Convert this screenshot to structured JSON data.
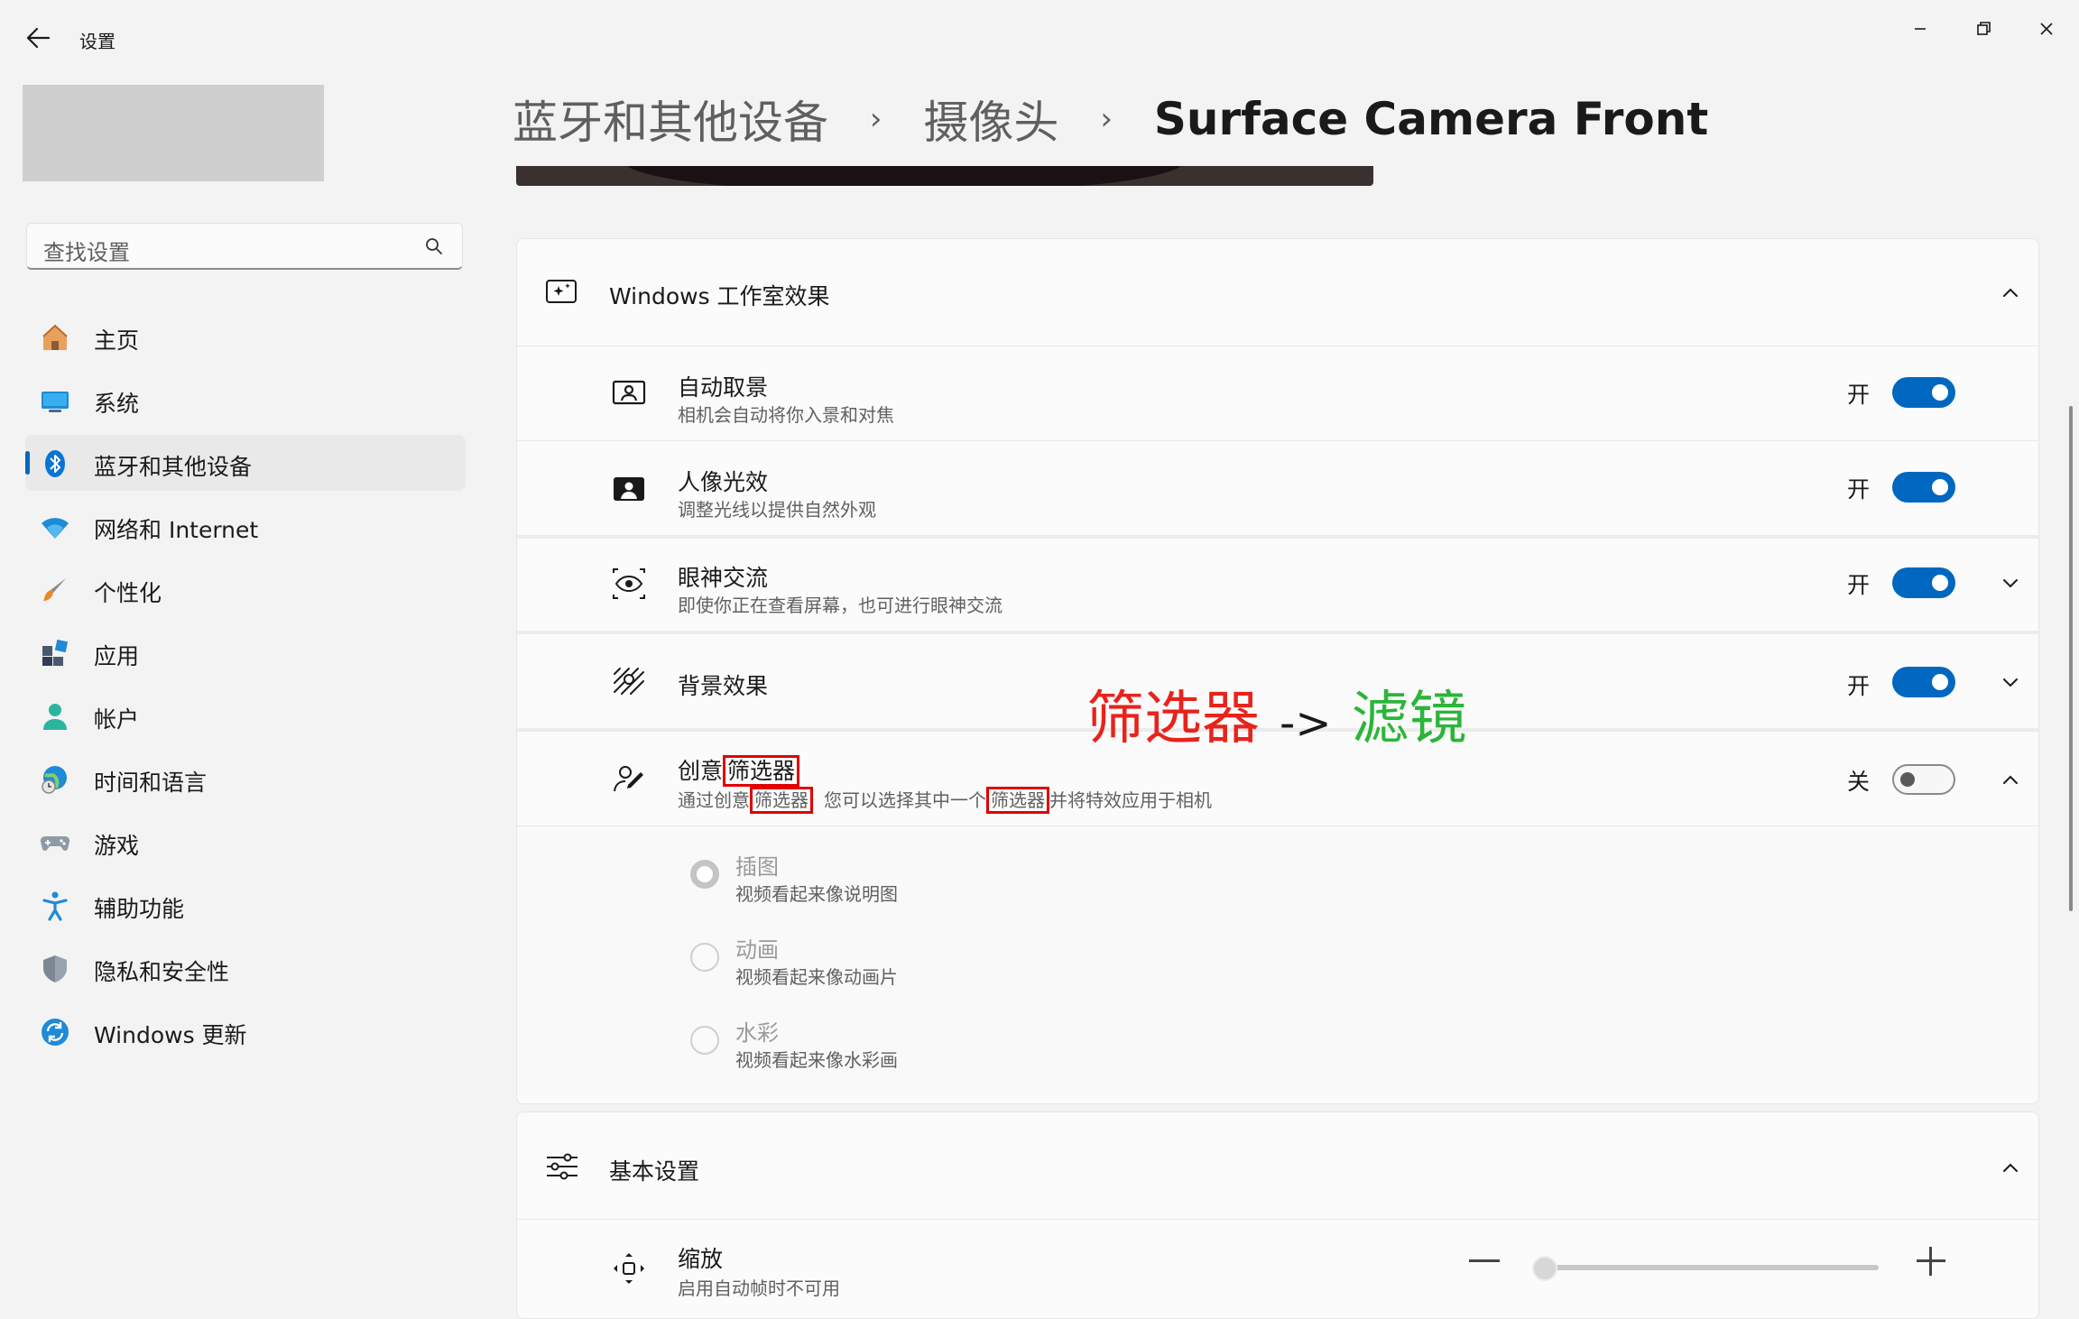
{
  "app": {
    "title": "设置"
  },
  "search": {
    "placeholder": "查找设置"
  },
  "sidebar": {
    "items": [
      {
        "label": "主页"
      },
      {
        "label": "系统"
      },
      {
        "label": "蓝牙和其他设备"
      },
      {
        "label": "网络和 Internet"
      },
      {
        "label": "个性化"
      },
      {
        "label": "应用"
      },
      {
        "label": "帐户"
      },
      {
        "label": "时间和语言"
      },
      {
        "label": "游戏"
      },
      {
        "label": "辅助功能"
      },
      {
        "label": "隐私和安全性"
      },
      {
        "label": "Windows 更新"
      }
    ],
    "active_index": 2
  },
  "breadcrumb": {
    "items": [
      "蓝牙和其他设备",
      "摄像头",
      "Surface Camera Front"
    ],
    "separator": "›"
  },
  "studio_effects": {
    "title": "Windows 工作室效果",
    "rows": [
      {
        "title": "自动取景",
        "subtitle": "相机会自动将你入景和对焦",
        "state": "开",
        "on": true
      },
      {
        "title": "人像光效",
        "subtitle": "调整光线以提供自然外观",
        "state": "开",
        "on": true
      },
      {
        "title": "眼神交流",
        "subtitle": "即使你正在查看屏幕，也可进行眼神交流",
        "state": "开",
        "on": true
      },
      {
        "title": "背景效果",
        "subtitle": "",
        "state": "开",
        "on": true
      },
      {
        "title_prefix": "创意",
        "title_highlight": "筛选器",
        "sub_part1": "通过创意",
        "sub_hl1": "筛选器",
        "sub_part2": "您可以选择其中一个",
        "sub_hl2": "筛选器",
        "sub_part3": "并将特效应用于相机",
        "state": "关",
        "on": false
      }
    ],
    "filters": [
      {
        "title": "插图",
        "subtitle": "视频看起来像说明图",
        "selected": true
      },
      {
        "title": "动画",
        "subtitle": "视频看起来像动画片",
        "selected": false
      },
      {
        "title": "水彩",
        "subtitle": "视频看起来像水彩画",
        "selected": false
      }
    ]
  },
  "annotation": {
    "from": "筛选器",
    "arrow": "->",
    "to": "滤镜",
    "from_color": "#e8231b",
    "to_color": "#2bb53a"
  },
  "basic_settings": {
    "title": "基本设置",
    "zoom": {
      "title": "缩放",
      "subtitle": "启用自动帧时不可用",
      "value": 0
    }
  },
  "colors": {
    "accent": "#0067c0"
  }
}
